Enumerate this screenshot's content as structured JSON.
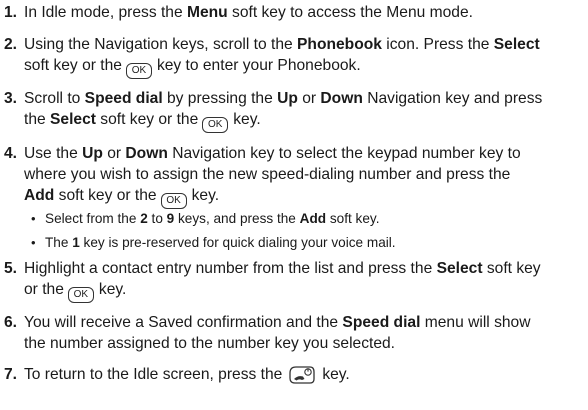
{
  "keys": {
    "ok_label": "OK",
    "end_icon": "end-power-key-icon"
  },
  "steps": [
    {
      "num": "1.",
      "l1_a": "In Idle mode, press the ",
      "l1_b": "Menu",
      "l1_c": " soft key to access the Menu mode."
    },
    {
      "num": "2.",
      "l1_a": "Using the Navigation keys, scroll to the ",
      "l1_b": "Phonebook",
      "l1_c": " icon. Press the ",
      "l1_d": "Select",
      "l2_a": "soft key or the",
      "l2_b": "key to enter your Phonebook."
    },
    {
      "num": "3.",
      "l1_a": "Scroll to ",
      "l1_b": "Speed dial",
      "l1_c": " by pressing the ",
      "l1_d": "Up",
      "l1_e": " or ",
      "l1_f": "Down",
      "l1_g": " Navigation key and press",
      "l2_a": "the ",
      "l2_b": "Select",
      "l2_c": " soft key or the",
      "l2_d": "key."
    },
    {
      "num": "4.",
      "l1_a": "Use the ",
      "l1_b": "Up",
      "l1_c": " or ",
      "l1_d": "Down",
      "l1_e": " Navigation key to select the keypad number key to",
      "l2": "where you wish to assign the new speed-dialing number and press the",
      "l3_a": "Add",
      "l3_b": " soft key or the",
      "l3_c": "key.",
      "sub1_a": "Select from the ",
      "sub1_b": "2",
      "sub1_c": " to ",
      "sub1_d": "9",
      "sub1_e": " keys, and press the ",
      "sub1_f": "Add",
      "sub1_g": " soft key.",
      "sub2_a": "The ",
      "sub2_b": "1",
      "sub2_c": " key is pre-reserved for quick dialing your voice mail."
    },
    {
      "num": "5.",
      "l1_a": "Highlight a contact entry number from the list and press the ",
      "l1_b": "Select",
      "l1_c": " soft key",
      "l2_a": "or the",
      "l2_b": "key."
    },
    {
      "num": "6.",
      "l1_a": "You will receive a Saved confirmation and the ",
      "l1_b": "Speed dial",
      "l1_c": " menu will show",
      "l2": "the number assigned to the number key you selected."
    },
    {
      "num": "7.",
      "l1_a": "To return to the Idle screen, press the",
      "l1_b": "key."
    }
  ],
  "bullet_glyph": "•"
}
